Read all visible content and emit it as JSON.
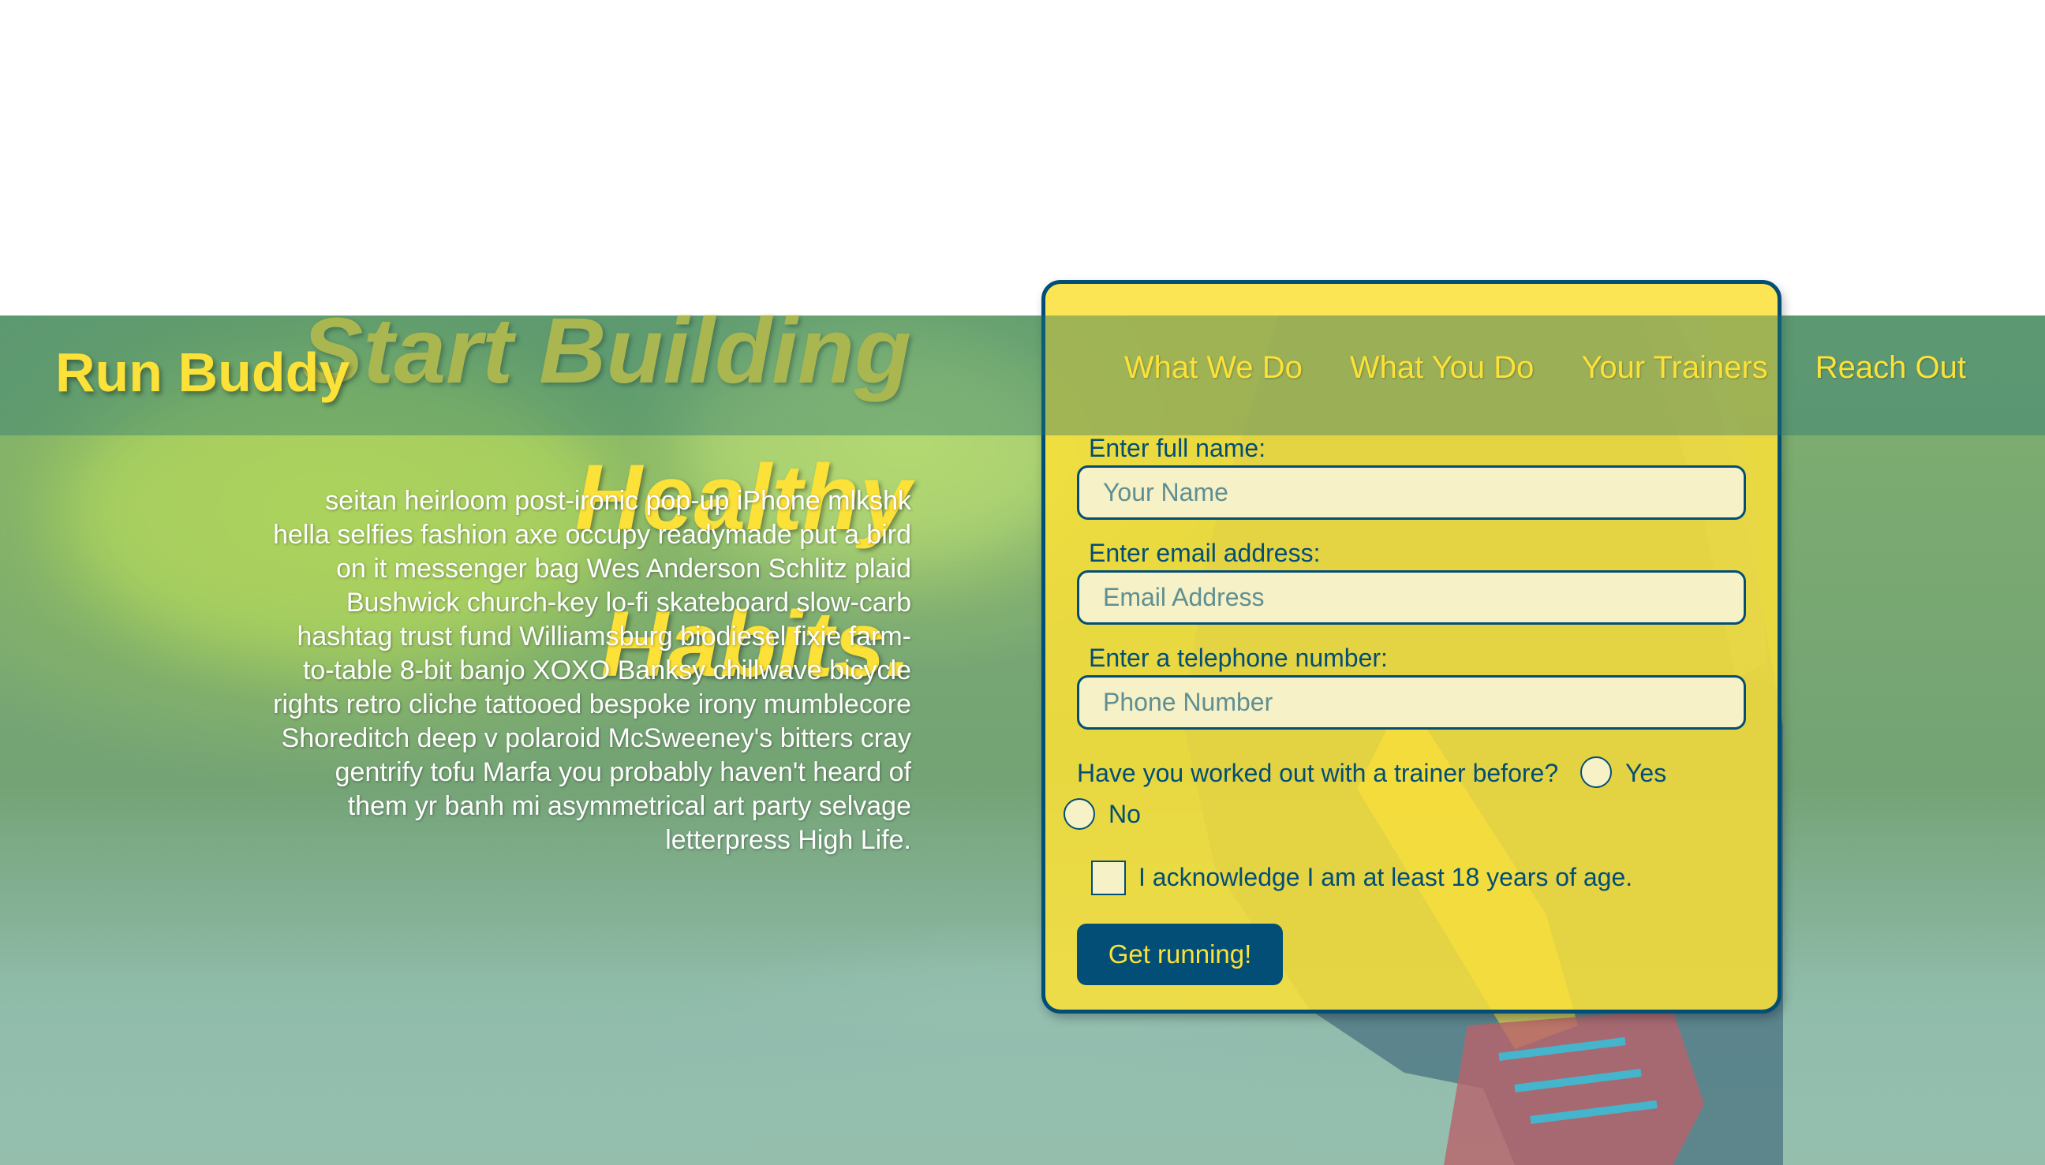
{
  "header": {
    "logo": "Run Buddy",
    "nav": [
      "What We Do",
      "What You Do",
      "Your Trainers",
      "Reach Out"
    ]
  },
  "hero": {
    "heading_lines": [
      "Start Building",
      "Healthy",
      "Habits."
    ],
    "copy": "seitan heirloom post-ironic pop-up iPhone mlkshk hella selfies fashion axe occupy readymade put a bird on it messenger bag Wes Anderson Schlitz plaid Bushwick church-key lo-fi skateboard slow-carb hashtag trust fund Williamsburg biodiesel fixie farm-to-table 8-bit banjo XOXO Banksy chillwave bicycle rights retro cliche tattooed bespoke irony mumblecore Shoreditch deep v polaroid McSweeney's bitters cray gentrify tofu Marfa you probably haven't heard of them yr banh mi asymmetrical art party selvage letterpress High Life."
  },
  "form": {
    "name_label": "Enter full name:",
    "name_placeholder": "Your Name",
    "email_label": "Enter email address:",
    "email_placeholder": "Email Address",
    "phone_label": "Enter a telephone number:",
    "phone_placeholder": "Phone Number",
    "question": "Have you worked out with a trainer before?",
    "yes_label": "Yes",
    "no_label": "No",
    "age_ack": "I acknowledge I am at least 18 years of age.",
    "submit_label": "Get running!"
  },
  "colors": {
    "primary_yellow": "#fce138",
    "primary_blue": "#024e76"
  }
}
